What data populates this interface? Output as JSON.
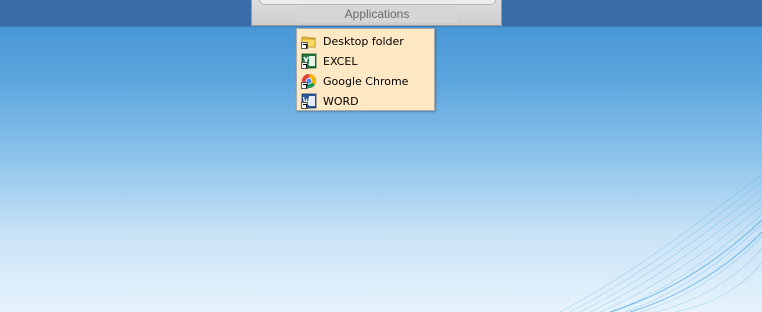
{
  "panel": {
    "label": "Applications"
  },
  "menu": {
    "items": [
      {
        "label": "Desktop folder",
        "icon": "folder-shortcut-icon"
      },
      {
        "label": "EXCEL",
        "icon": "excel-shortcut-icon"
      },
      {
        "label": "Google Chrome",
        "icon": "chrome-shortcut-icon"
      },
      {
        "label": "WORD",
        "icon": "word-shortcut-icon"
      }
    ]
  },
  "colors": {
    "topbar": "#3a6da8",
    "menu_background": "#ffe8c4",
    "panel": "#d6d6d6"
  }
}
